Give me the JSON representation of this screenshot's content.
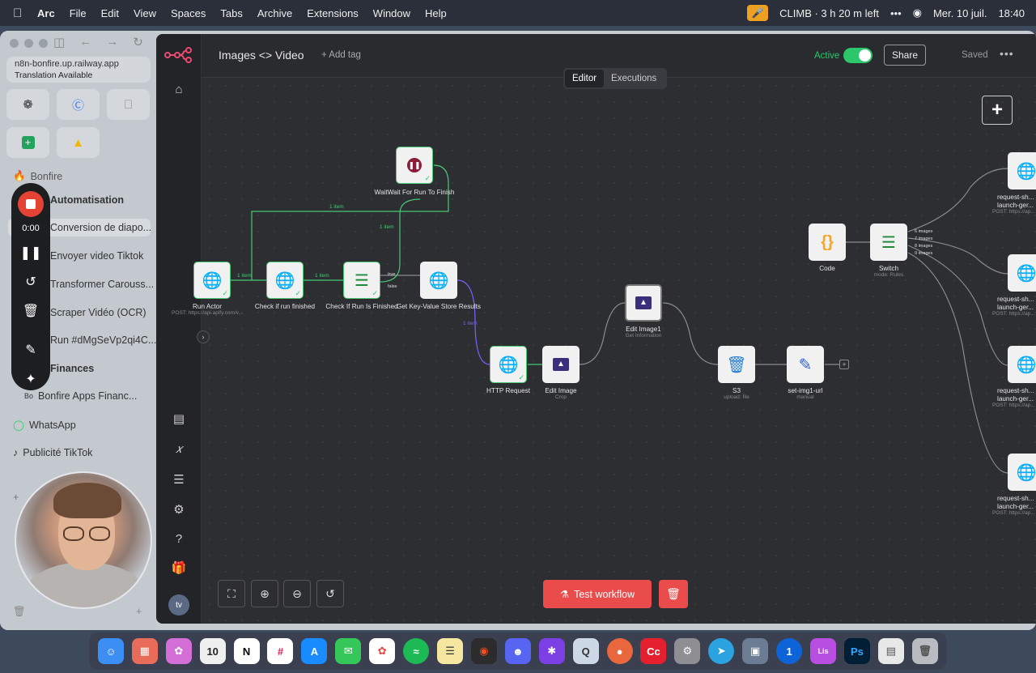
{
  "menubar": {
    "apple": "",
    "app": "Arc",
    "items": [
      "File",
      "Edit",
      "View",
      "Spaces",
      "Tabs",
      "Archive",
      "Extensions",
      "Window",
      "Help"
    ],
    "status": "CLIMB · 3 h 20 m left",
    "date": "Mer. 10 juil.",
    "time": "18:40"
  },
  "sidebar": {
    "url": "n8n-bonfire.up.railway.app",
    "translation": "Translation Available",
    "space": "Bonfire",
    "folder": "Automatisation",
    "items": [
      "Conversion de diapo...",
      "Envoyer video Tiktok",
      "Transformer Carouss...",
      "Scraper Vidéo (OCR)",
      "Run #dMgSeVp2qi4C...",
      "Finances",
      "Bonfire Apps Financ...",
      "WhatsApp",
      "Publicité TikTok"
    ],
    "bonfire_icon": "Bo"
  },
  "recorder": {
    "time": "0:00"
  },
  "n8n": {
    "title": "Images <> Video",
    "add_tag": "+ Add tag",
    "active": "Active",
    "share": "Share",
    "saved": "Saved",
    "more": "•••",
    "tabs": [
      "Editor",
      "Executions"
    ],
    "test_button": "Test workflow",
    "avatar": "tv",
    "nodes": {
      "actor": "Run Actor",
      "actor_sub": "POST: https://api.apify.com/v...",
      "check1": "Check if run finished",
      "check2": "Check If Run Is Finished",
      "wait": "WaitWait For Run To Finish",
      "kv": "Get Key-Value Store Results",
      "http": "HTTP Request",
      "edit": "Edit Image",
      "edit_sub": "Crop",
      "edit1": "Edit Image1",
      "edit1_sub": "Get Information",
      "s3": "S3",
      "s3_sub": "upload: file",
      "setimg": "set-img1-url",
      "setimg_sub": "manual",
      "code": "Code",
      "switch": "Switch",
      "switch_sub": "mode: Rules",
      "req": "request-sh... launch-ger...",
      "req_sub": "POST: https://ap..."
    },
    "edge_labels": {
      "item": "1 item",
      "true": "true",
      "false": "false",
      "img6": "6 images",
      "img7": "7 images",
      "img8": "8 images",
      "img9": "9 images"
    }
  },
  "colors": {
    "accent": "#ea4b4b",
    "active": "#2cc76b",
    "edge": "#8a8b90",
    "edge_green": "#48c774"
  }
}
